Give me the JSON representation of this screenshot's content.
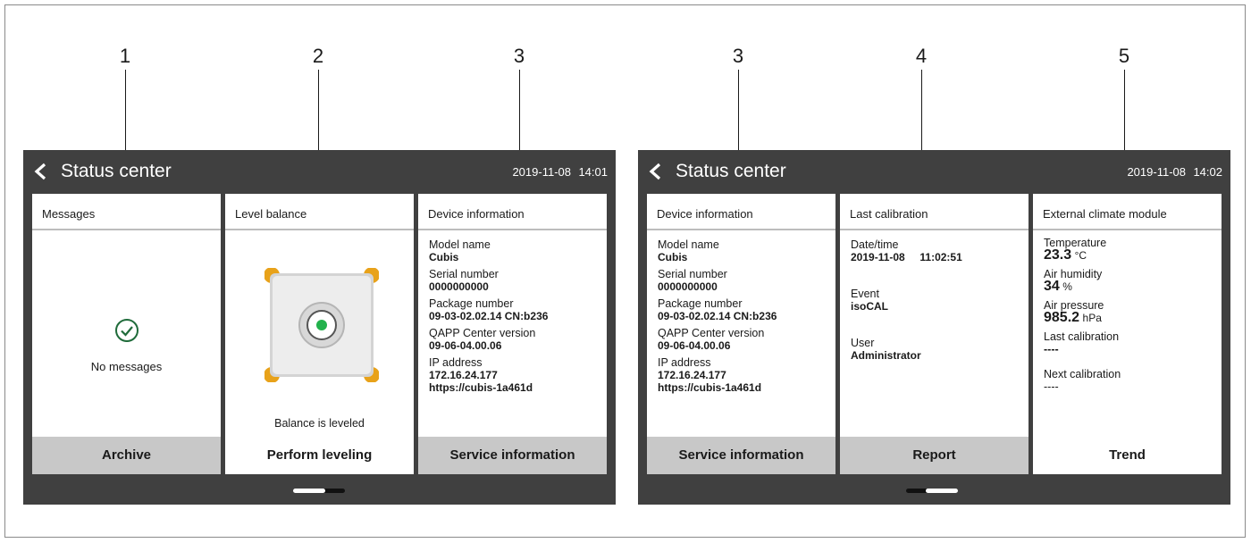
{
  "callouts": [
    "1",
    "2",
    "3",
    "3",
    "4",
    "5"
  ],
  "screen_left": {
    "title": "Status center",
    "date": "2019-11-08",
    "time": "14:01",
    "messages": {
      "header": "Messages",
      "text": "No messages",
      "button": "Archive",
      "icon": "check-circle-icon"
    },
    "level": {
      "header": "Level balance",
      "status": "Balance is leveled",
      "button": "Perform leveling",
      "bubble_color": "#22b14c"
    },
    "device": {
      "header": "Device information",
      "model_label": "Model name",
      "model_value": "Cubis",
      "serial_label": "Serial number",
      "serial_value": "0000000000",
      "package_label": "Package number",
      "package_value": "09-03-02.02.14 CN:b236",
      "qapp_label": "QAPP Center version",
      "qapp_value": "09-06-04.00.06",
      "ip_label": "IP address",
      "ip_value": "172.16.24.177",
      "url_value": "https://cubis-1a461d",
      "button": "Service information"
    }
  },
  "screen_right": {
    "title": "Status center",
    "date": "2019-11-08",
    "time": "14:02",
    "device": {
      "header": "Device information",
      "model_label": "Model name",
      "model_value": "Cubis",
      "serial_label": "Serial number",
      "serial_value": "0000000000",
      "package_label": "Package number",
      "package_value": "09-03-02.02.14 CN:b236",
      "qapp_label": "QAPP Center version",
      "qapp_value": "09-06-04.00.06",
      "ip_label": "IP address",
      "ip_value": "172.16.24.177",
      "url_value": "https://cubis-1a461d",
      "button": "Service information"
    },
    "calibration": {
      "header": "Last calibration",
      "date_label": "Date/time",
      "date_value": "2019-11-08",
      "time_value": "11:02:51",
      "event_label": "Event",
      "event_value": "isoCAL",
      "user_label": "User",
      "user_value": "Administrator",
      "button": "Report"
    },
    "climate": {
      "header": "External climate module",
      "temp_label": "Temperature",
      "temp_value": "23.3",
      "temp_unit": "°C",
      "hum_label": "Air humidity",
      "hum_value": "34",
      "hum_unit": "%",
      "press_label": "Air pressure",
      "press_value": "985.2",
      "press_unit": "hPa",
      "last_label": "Last calibration",
      "last_value": "----",
      "next_label": "Next calibration",
      "next_value": "----",
      "button": "Trend"
    }
  },
  "colors": {
    "bar": "#404040",
    "footer_grey": "#c8c8c8",
    "accent_orange": "#e8a21a",
    "accent_green": "#22b14c"
  }
}
